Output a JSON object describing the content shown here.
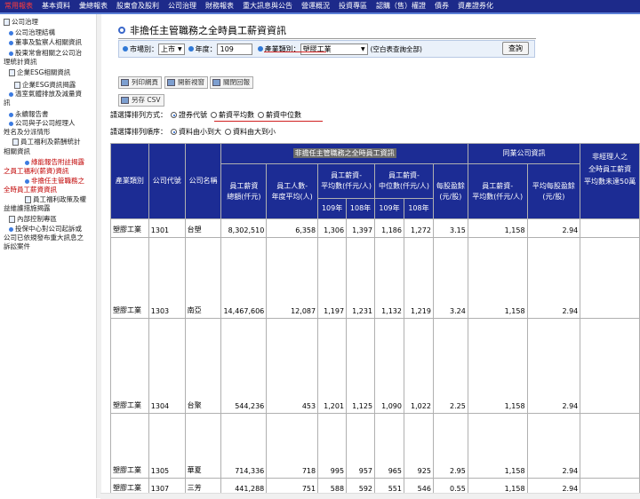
{
  "topnav": [
    {
      "label": "常用報表",
      "active": true
    },
    {
      "label": "基本資料"
    },
    {
      "label": "彙總報表"
    },
    {
      "label": "股東會及股利"
    },
    {
      "label": "公司治理"
    },
    {
      "label": "財務報表"
    },
    {
      "label": "重大訊息與公告"
    },
    {
      "label": "營運概況"
    },
    {
      "label": "投資專區"
    },
    {
      "label": "認購（售）權證"
    },
    {
      "label": "債券"
    },
    {
      "label": "資產證券化"
    }
  ],
  "sidebar": [
    {
      "t": "公司治理",
      "kind": "doc"
    },
    {
      "t": "公司治理結構",
      "kind": "dot"
    },
    {
      "t": "董事及監察人相關資訊",
      "kind": "dot"
    },
    {
      "t": "股東常會相關之公司治",
      "kind": "dot"
    },
    {
      "t": "理統計資訊",
      "kind": "none"
    },
    {
      "t": "企業ESG相關資訊",
      "kind": "doc"
    },
    {
      "t": "企業ESG資訊揭露",
      "kind": "doc"
    },
    {
      "t": "溫室氣體排放及減量資",
      "kind": "dot"
    },
    {
      "t": "訊",
      "kind": "none"
    },
    {
      "t": "永續報告書",
      "kind": "dot"
    },
    {
      "t": "公司與子公司經理人",
      "kind": "dot"
    },
    {
      "t": "姓名及分派情形",
      "kind": "none"
    },
    {
      "t": "員工福利及薪酬統計",
      "kind": "doc"
    },
    {
      "t": "相關資訊",
      "kind": "none"
    },
    {
      "t": "綠能報告附註揭露",
      "kind": "dot",
      "red": true
    },
    {
      "t": "之員工福利(薪資)資訊",
      "kind": "none",
      "red": true
    },
    {
      "t": "非擔任主管職務之",
      "kind": "dot",
      "red": true
    },
    {
      "t": "全時員工薪資資訊",
      "kind": "none",
      "red": true
    },
    {
      "t": "員工福利政策及權",
      "kind": "doc"
    },
    {
      "t": "益維護措施揭露",
      "kind": "none"
    },
    {
      "t": "內部控制專區",
      "kind": "doc"
    },
    {
      "t": "投保中心對公司起訴或",
      "kind": "dot"
    },
    {
      "t": "公司已依規發布重大訊息之",
      "kind": "none"
    },
    {
      "t": "訴訟案件",
      "kind": "none"
    }
  ],
  "page_title": "非擔任主管職務之全時員工薪資資訊",
  "filters": {
    "market_label": "市場別：",
    "market_value": "上市",
    "year_label": "年度：",
    "year_value": "109",
    "industry_label": "產業類別：",
    "industry_value": "塑膠工業",
    "note": "(空白表查詢全部)",
    "query_button": "查詢"
  },
  "toolbar": {
    "print": "列印網頁",
    "new_window": "開新視窗",
    "close": "關閉回報",
    "save_csv": "另存 CSV"
  },
  "sort_by": {
    "label": "請選擇排列方式：",
    "options": [
      "證券代號",
      "薪資平均數",
      "薪資中位數"
    ],
    "selected": 0
  },
  "sort_order": {
    "label": "請選擇排列順序：",
    "options": [
      "資料由小到大",
      "資料由大到小"
    ],
    "selected": 0
  },
  "table": {
    "group_header_1": "非擔任主管職務之全時員工資訊",
    "group_header_2": "同業公司資訊",
    "group_header_3a": "非經理人之",
    "group_header_3b": "全時員工薪資",
    "group_header_3c": "平均數未達50萬",
    "col_industry": "產業類別",
    "col_code": "公司代號",
    "col_name": "公司名稱",
    "col_total_a": "員工薪資",
    "col_total_b": "總額(仟元)",
    "col_count_a": "員工人數-",
    "col_count_b": "年度平均(人)",
    "col_avg_a": "員工薪資-",
    "col_avg_b": "平均數(仟元/人)",
    "col_med_a": "員工薪資-",
    "col_med_b": "中位數(仟元/人)",
    "col_eps_a": "每股盈餘",
    "col_eps_b": "(元/股)",
    "col_peer_avg_a": "員工薪資-",
    "col_peer_avg_b": "平均數(仟元/人)",
    "col_peer_eps_a": "平均每股盈餘",
    "col_peer_eps_b": "(元/股)",
    "y1": "109年",
    "y2": "108年",
    "rows": [
      {
        "industry": "塑膠工業",
        "code": "1301",
        "name": "台塑",
        "total": "8,302,510",
        "count": "6,358",
        "avg109": "1,306",
        "avg108": "1,397",
        "med109": "1,186",
        "med108": "1,272",
        "eps": "3.15",
        "peer_avg": "1,158",
        "peer_eps": "2.94"
      },
      {
        "industry": "塑膠工業",
        "code": "1303",
        "name": "南亞",
        "total": "14,467,606",
        "count": "12,087",
        "avg109": "1,197",
        "avg108": "1,231",
        "med109": "1,132",
        "med108": "1,219",
        "eps": "3.24",
        "peer_avg": "1,158",
        "peer_eps": "2.94"
      },
      {
        "industry": "塑膠工業",
        "code": "1304",
        "name": "台聚",
        "total": "544,236",
        "count": "453",
        "avg109": "1,201",
        "avg108": "1,125",
        "med109": "1,090",
        "med108": "1,022",
        "eps": "2.25",
        "peer_avg": "1,158",
        "peer_eps": "2.94"
      },
      {
        "industry": "塑膠工業",
        "code": "1305",
        "name": "華夏",
        "total": "714,336",
        "count": "718",
        "avg109": "995",
        "avg108": "957",
        "med109": "965",
        "med108": "925",
        "eps": "2.95",
        "peer_avg": "1,158",
        "peer_eps": "2.94"
      },
      {
        "industry": "塑膠工業",
        "code": "1307",
        "name": "三芳",
        "total": "441,288",
        "count": "751",
        "avg109": "588",
        "avg108": "592",
        "med109": "551",
        "med108": "546",
        "eps": "0.55",
        "peer_avg": "1,158",
        "peer_eps": "2.94"
      }
    ]
  }
}
